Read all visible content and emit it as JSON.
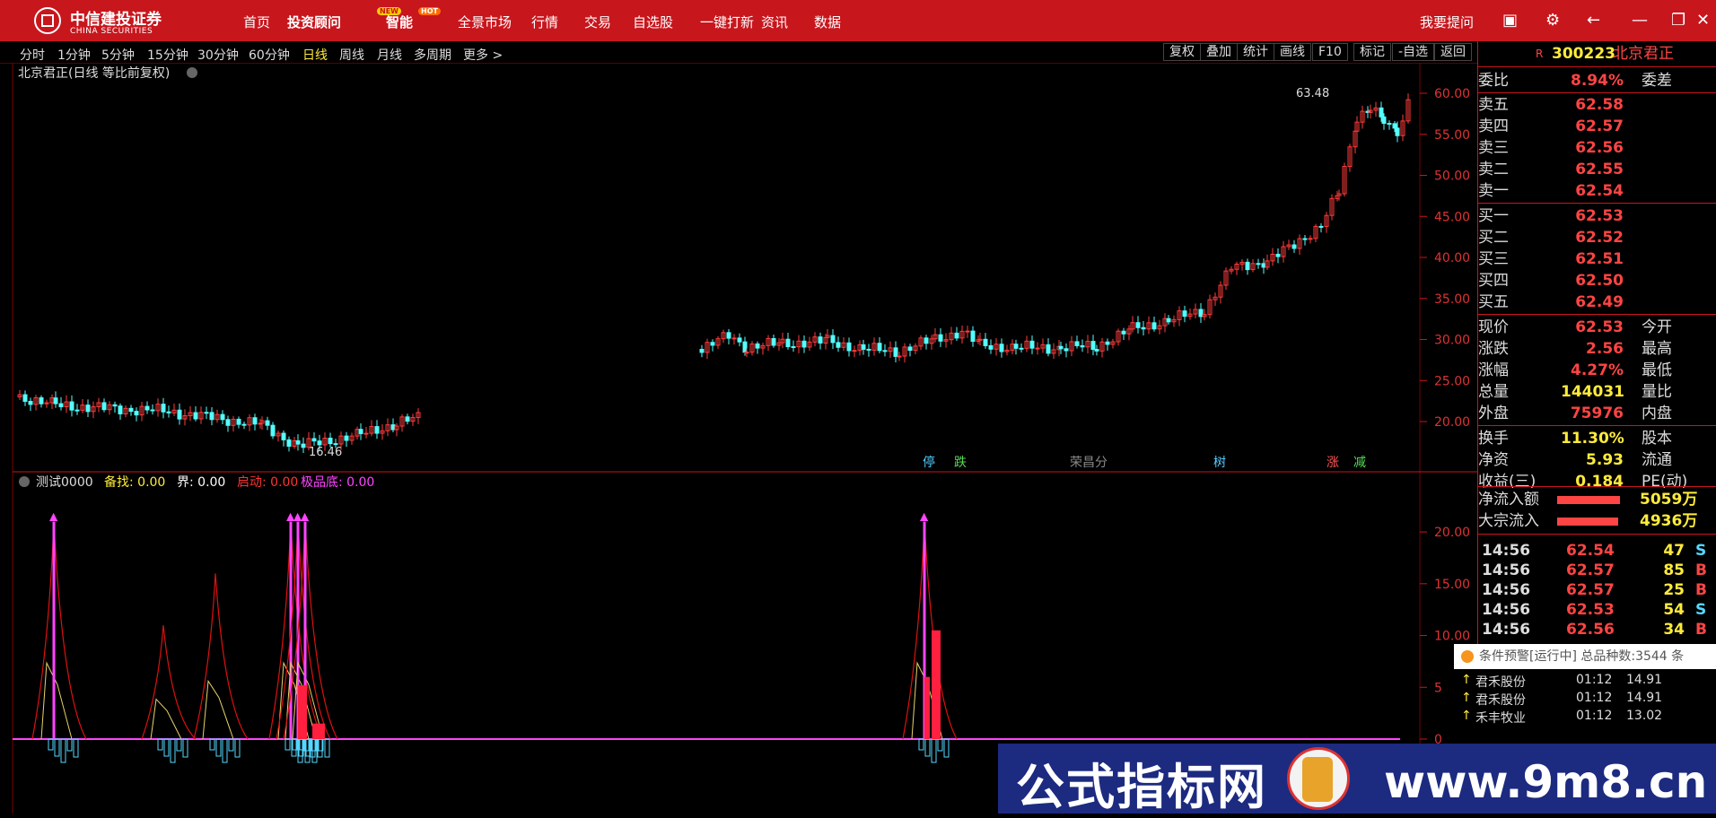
{
  "brand": {
    "name_cn": "中信建投证券",
    "name_en": "CHINA SECURITIES"
  },
  "nav": {
    "items": [
      "首页",
      "投资顾问",
      "智能",
      "全景市场",
      "行情",
      "交易",
      "自选股",
      "一键打新",
      "资讯",
      "数据"
    ],
    "badge_new": "NEW",
    "badge_hot": "HOT",
    "ask": "我要提问"
  },
  "timeframes": [
    "分时",
    "1分钟",
    "5分钟",
    "15分钟",
    "30分钟",
    "60分钟",
    "日线",
    "周线",
    "月线",
    "多周期",
    "更多 >"
  ],
  "active_timeframe": "日线",
  "tools": [
    "复权",
    "叠加",
    "统计",
    "画线",
    "F10",
    "标记",
    "-自选",
    "返回"
  ],
  "chart": {
    "title": "北京君正(日线 等比前复权)",
    "high_label": "63.48",
    "low_label": "16.46",
    "price_ticks": [
      "60.00",
      "55.00",
      "50.00",
      "45.00",
      "40.00",
      "35.00",
      "30.00",
      "25.00",
      "20.00"
    ],
    "markers": [
      {
        "text": "停",
        "color": "#55ccff"
      },
      {
        "text": "跌",
        "color": "#55dd55"
      },
      {
        "text": "荣昌分",
        "color": "#888888"
      },
      {
        "text": "树",
        "color": "#55ccff"
      },
      {
        "text": "涨",
        "color": "#ff5555"
      },
      {
        "text": "减",
        "color": "#55dd55"
      }
    ]
  },
  "indicator": {
    "name": "测试0000",
    "items": [
      {
        "label": "备找: 0.00",
        "color": "#ffeb3b"
      },
      {
        "label": "界: 0.00",
        "color": "#ffffff"
      },
      {
        "label": "启动: 0.00",
        "color": "#ff3333"
      },
      {
        "label": "极品底: 0.00",
        "color": "#ff44ff"
      }
    ],
    "ticks": [
      "20.00",
      "15.00",
      "10.00",
      "5",
      "0"
    ]
  },
  "quote": {
    "code": "300223",
    "name": "北京君正",
    "weibi": {
      "label": "委比",
      "value": "8.94%",
      "label2": "委差"
    },
    "sells": [
      {
        "label": "卖五",
        "price": "62.58"
      },
      {
        "label": "卖四",
        "price": "62.57"
      },
      {
        "label": "卖三",
        "price": "62.56"
      },
      {
        "label": "卖二",
        "price": "62.55"
      },
      {
        "label": "卖一",
        "price": "62.54"
      }
    ],
    "buys": [
      {
        "label": "买一",
        "price": "62.53"
      },
      {
        "label": "买二",
        "price": "62.52"
      },
      {
        "label": "买三",
        "price": "62.51"
      },
      {
        "label": "买四",
        "price": "62.50"
      },
      {
        "label": "买五",
        "price": "62.49"
      }
    ],
    "stats": [
      {
        "label": "现价",
        "value": "62.53",
        "label2": "今开"
      },
      {
        "label": "涨跌",
        "value": "2.56",
        "label2": "最高"
      },
      {
        "label": "涨幅",
        "value": "4.27%",
        "label2": "最低"
      },
      {
        "label": "总量",
        "value": "144031",
        "label2": "量比",
        "vcolor": "#ffeb3b"
      },
      {
        "label": "外盘",
        "value": "75976",
        "label2": "内盘",
        "vcolor": "#ff4444"
      },
      {
        "label": "换手",
        "value": "11.30%",
        "label2": "股本",
        "vcolor": "#ffeb3b"
      },
      {
        "label": "净资",
        "value": "5.93",
        "label2": "流通",
        "vcolor": "#ffeb3b"
      },
      {
        "label": "收益(三)",
        "value": "0.184",
        "label2": "PE(动)",
        "vcolor": "#ffeb3b"
      }
    ],
    "flows": [
      {
        "label": "净流入额",
        "value": "5059万"
      },
      {
        "label": "大宗流入",
        "value": "4936万"
      }
    ],
    "trades": [
      {
        "time": "14:56",
        "price": "62.54",
        "vol": "47",
        "side": "S"
      },
      {
        "time": "14:56",
        "price": "62.57",
        "vol": "85",
        "side": "B"
      },
      {
        "time": "14:56",
        "price": "62.57",
        "vol": "25",
        "side": "B"
      },
      {
        "time": "14:56",
        "price": "62.53",
        "vol": "54",
        "side": "S"
      },
      {
        "time": "14:56",
        "price": "62.56",
        "vol": "34",
        "side": "B"
      }
    ]
  },
  "alert": {
    "text": "条件预警[运行中] 总品种数:3544 条",
    "rows": [
      {
        "name": "君禾股份",
        "time": "01:12",
        "price": "14.91"
      },
      {
        "name": "君禾股份",
        "time": "01:12",
        "price": "14.91"
      },
      {
        "name": "禾丰牧业",
        "time": "01:12",
        "price": "13.02"
      }
    ]
  },
  "watermark": {
    "left": "公式指标网",
    "right": "www.9m8.cn"
  }
}
